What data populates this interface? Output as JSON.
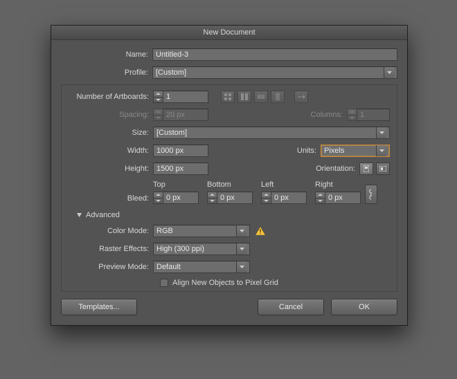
{
  "title": "New Document",
  "name": {
    "label": "Name:",
    "value": "Untitled-3"
  },
  "profile": {
    "label": "Profile:",
    "value": "[Custom]"
  },
  "artboards": {
    "label": "Number of Artboards:",
    "value": "1",
    "spacing_label": "Spacing:",
    "spacing_value": "20 px",
    "columns_label": "Columns:",
    "columns_value": "1"
  },
  "size": {
    "label": "Size:",
    "value": "[Custom]"
  },
  "width": {
    "label": "Width:",
    "value": "1000 px"
  },
  "height": {
    "label": "Height:",
    "value": "1500 px"
  },
  "units": {
    "label": "Units:",
    "value": "Pixels"
  },
  "orientation": {
    "label": "Orientation:"
  },
  "bleed": {
    "label": "Bleed:",
    "top_label": "Top",
    "top": "0 px",
    "bottom_label": "Bottom",
    "bottom": "0 px",
    "left_label": "Left",
    "left": "0 px",
    "right_label": "Right",
    "right": "0 px"
  },
  "advanced": {
    "label": "Advanced",
    "color_mode": {
      "label": "Color Mode:",
      "value": "RGB"
    },
    "raster": {
      "label": "Raster Effects:",
      "value": "High (300 ppi)"
    },
    "preview": {
      "label": "Preview Mode:",
      "value": "Default"
    },
    "align_label": "Align New Objects to Pixel Grid"
  },
  "buttons": {
    "templates": "Templates...",
    "cancel": "Cancel",
    "ok": "OK"
  }
}
